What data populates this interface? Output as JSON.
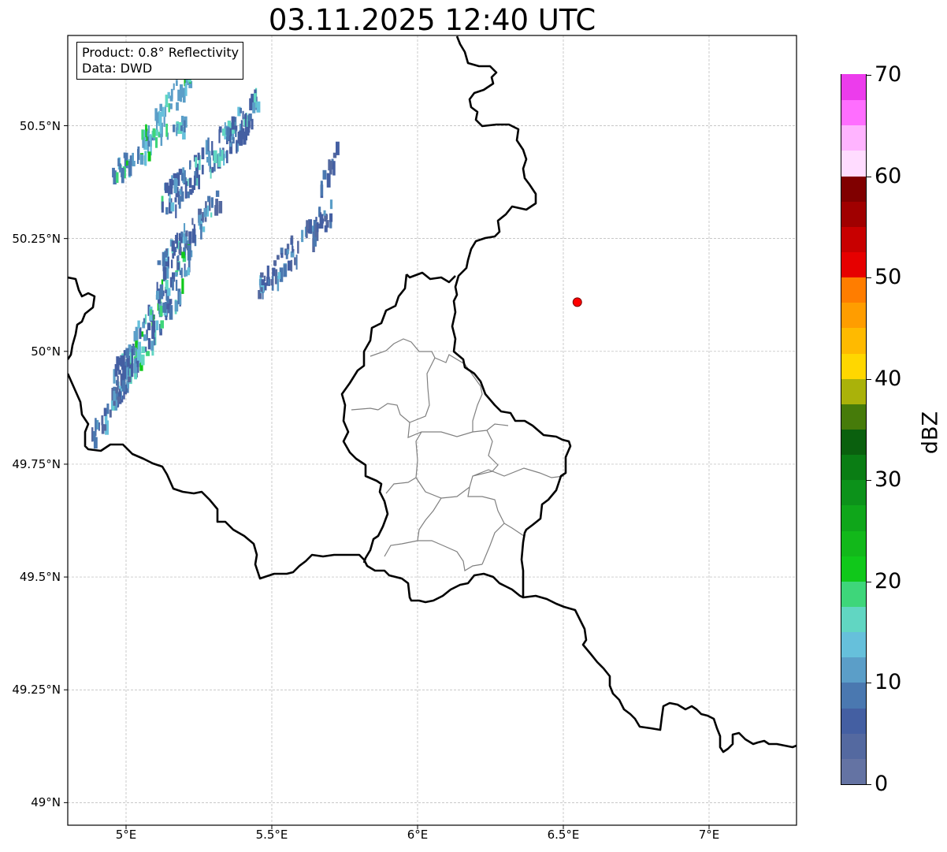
{
  "title": "03.11.2025 12:40 UTC",
  "info_box": {
    "product": "Product: 0.8° Reflectivity",
    "source": "Data: DWD"
  },
  "map": {
    "lon_range": [
      4.8,
      7.3
    ],
    "lat_range": [
      48.95,
      50.7
    ],
    "lon_ticks": [
      {
        "value": 5.0,
        "label": "5°E"
      },
      {
        "value": 5.5,
        "label": "5.5°E"
      },
      {
        "value": 6.0,
        "label": "6°E"
      },
      {
        "value": 6.5,
        "label": "6.5°E"
      },
      {
        "value": 7.0,
        "label": "7°E"
      }
    ],
    "lat_ticks": [
      {
        "value": 49.0,
        "label": "49°N"
      },
      {
        "value": 49.25,
        "label": "49.25°N"
      },
      {
        "value": 49.5,
        "label": "49.5°N"
      },
      {
        "value": 49.75,
        "label": "49.75°N"
      },
      {
        "value": 50.0,
        "label": "50°N"
      },
      {
        "value": 50.25,
        "label": "50.25°N"
      },
      {
        "value": 50.5,
        "label": "50.5°N"
      }
    ],
    "gridlines": true,
    "marker": {
      "lon": 6.548,
      "lat": 50.109,
      "color": "#ff0000"
    },
    "echoes": [
      {
        "lon": [
          4.95,
          5.2
        ],
        "lat": [
          50.4,
          50.52
        ],
        "dbz": [
          8,
          22
        ]
      },
      {
        "lon": [
          5.05,
          5.22
        ],
        "lat": [
          50.47,
          50.62
        ],
        "dbz": [
          10,
          24
        ]
      },
      {
        "lon": [
          5.12,
          5.45
        ],
        "lat": [
          50.33,
          50.55
        ],
        "dbz": [
          5,
          18
        ]
      },
      {
        "lon": [
          5.1,
          5.32
        ],
        "lat": [
          50.18,
          50.35
        ],
        "dbz": [
          4,
          16
        ]
      },
      {
        "lon": [
          5.45,
          5.7
        ],
        "lat": [
          50.15,
          50.32
        ],
        "dbz": [
          4,
          14
        ]
      },
      {
        "lon": [
          5.65,
          5.72
        ],
        "lat": [
          50.35,
          50.45
        ],
        "dbz": [
          4,
          10
        ]
      },
      {
        "lon": [
          4.95,
          5.22
        ],
        "lat": [
          49.92,
          50.22
        ],
        "dbz": [
          6,
          22
        ]
      },
      {
        "lon": [
          4.88,
          5.02
        ],
        "lat": [
          49.82,
          49.98
        ],
        "dbz": [
          4,
          14
        ]
      }
    ]
  },
  "colorbar": {
    "label": "dBZ",
    "range": [
      0,
      70
    ],
    "ticks": [
      "0",
      "10",
      "20",
      "30",
      "40",
      "50",
      "60",
      "70"
    ],
    "colors": [
      "#6473a3",
      "#5469a0",
      "#445fa2",
      "#4a78b0",
      "#5b9ec8",
      "#66c0db",
      "#61d6c2",
      "#3ed67a",
      "#10c81a",
      "#12b81a",
      "#0fa61a",
      "#0c921a",
      "#0a7d14",
      "#0a600e",
      "#467b0a",
      "#aab20a",
      "#ffd700",
      "#ffba00",
      "#ff9d00",
      "#ff7d00",
      "#e60000",
      "#c80000",
      "#a00000",
      "#800000",
      "#ffdcff",
      "#ffb4ff",
      "#ff6eff",
      "#ec3cec"
    ]
  }
}
